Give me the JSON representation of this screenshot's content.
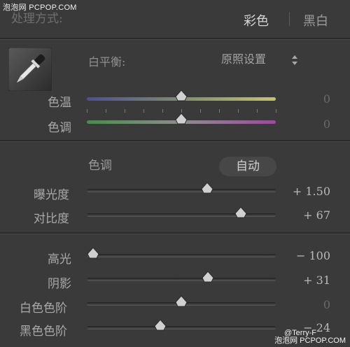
{
  "watermark": "泡泡网 PCPOP.COM",
  "treatment": {
    "label": "处理方式:",
    "options": [
      "彩色",
      "黑白"
    ],
    "selected": "彩色"
  },
  "white_balance": {
    "label": "白平衡:",
    "value": "原照设置",
    "sliders": [
      {
        "label": "色温",
        "value": "0",
        "position": 0.5
      },
      {
        "label": "色调",
        "value": "0",
        "position": 0.5
      }
    ]
  },
  "tone": {
    "title": "色调",
    "auto_label": "自动",
    "sliders": [
      {
        "label": "曝光度",
        "value": "+ 1.50",
        "position": 0.65
      },
      {
        "label": "对比度",
        "value": "+ 67",
        "position": 0.83
      }
    ]
  },
  "presence": {
    "sliders": [
      {
        "label": "高光",
        "value": "− 100",
        "position": 0.0
      },
      {
        "label": "阴影",
        "value": "+ 31",
        "position": 0.65
      },
      {
        "label": "白色色阶",
        "value": "0",
        "position": 0.5
      },
      {
        "label": "黑色色阶",
        "value": "− 24",
        "position": 0.39
      }
    ]
  },
  "credits": {
    "author": "@Terry-F",
    "site": "泡泡网 PCPOP.COM"
  }
}
